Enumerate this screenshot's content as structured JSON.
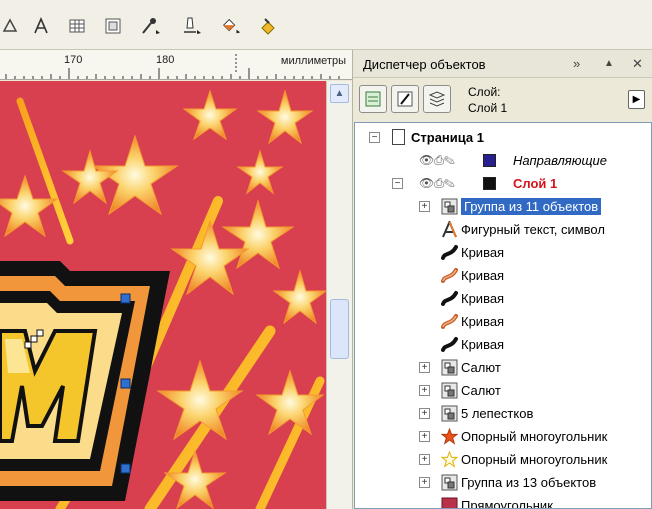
{
  "toolbar": {
    "tools": [
      "shape-tool-icon",
      "text-tool-icon",
      "table-tool-icon",
      "frame-tool-icon",
      "eyedropper-tool-icon",
      "outline-tool-icon",
      "fill-tool-icon",
      "interactive-fill-tool-icon"
    ]
  },
  "ruler": {
    "marks": [
      "170",
      "180"
    ],
    "unit": "миллиметры"
  },
  "docker": {
    "title": "Диспетчер объектов",
    "layer_label": "Слой:",
    "layer_name": "Слой 1",
    "tree": {
      "page": "Страница 1",
      "guides": "Направляющие",
      "layer": "Слой 1",
      "items": [
        {
          "label": "Группа из 11 объектов",
          "icon": "group-icon",
          "expandable": true,
          "selected": true
        },
        {
          "label": "Фигурный текст, символ",
          "icon": "artistic-text-icon",
          "expandable": false
        },
        {
          "label": "Кривая",
          "icon": "curve-icon-dark",
          "expandable": false
        },
        {
          "label": "Кривая",
          "icon": "curve-icon-orange",
          "expandable": false
        },
        {
          "label": "Кривая",
          "icon": "curve-icon-dark",
          "expandable": false
        },
        {
          "label": "Кривая",
          "icon": "curve-icon-orange",
          "expandable": false
        },
        {
          "label": "Кривая",
          "icon": "curve-icon-dark",
          "expandable": false
        },
        {
          "label": "Салют",
          "icon": "group-icon",
          "expandable": true
        },
        {
          "label": "Салют",
          "icon": "group-icon",
          "expandable": true
        },
        {
          "label": "5 лепестков",
          "icon": "group-icon",
          "expandable": true
        },
        {
          "label": "Опорный многоугольник",
          "icon": "star-filled-icon",
          "expandable": true
        },
        {
          "label": "Опорный многоугольник",
          "icon": "star-outline-icon",
          "expandable": true
        },
        {
          "label": "Группа из 13 объектов",
          "icon": "group-icon",
          "expandable": true
        },
        {
          "label": "Прямоугольник",
          "icon": "rectangle-icon",
          "expandable": false
        }
      ]
    }
  },
  "colors": {
    "guides_swatch": "#2a1f8f",
    "layer_swatch": "#111111",
    "layer_name_color": "#d4121c",
    "selection": "#316ac5",
    "canvas_bg": "#d9404f"
  }
}
